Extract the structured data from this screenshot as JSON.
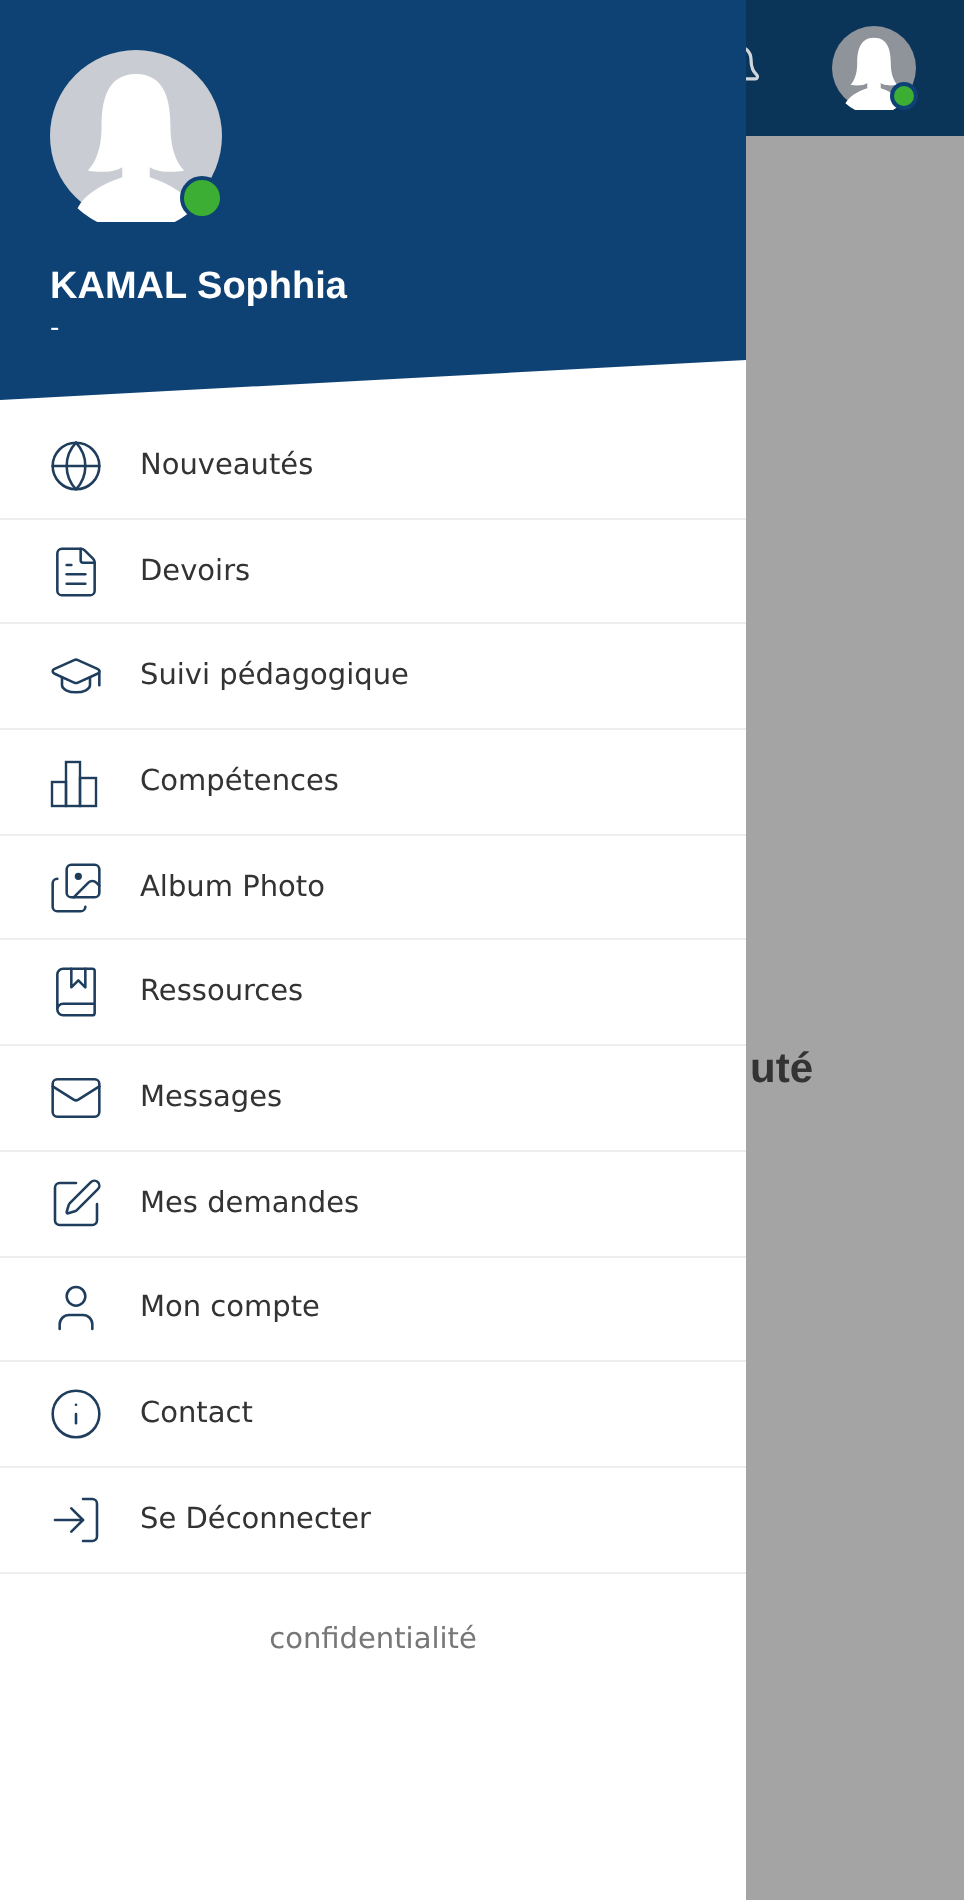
{
  "background": {
    "title_fragment": "uté",
    "user_online": true
  },
  "profile": {
    "name": "KAMAL Sophhia",
    "subtitle": "-",
    "online": true
  },
  "menu": [
    {
      "kind": "globe",
      "label": "Nouveautés"
    },
    {
      "kind": "document",
      "label": "Devoirs"
    },
    {
      "kind": "cap",
      "label": "Suivi pédagogique"
    },
    {
      "kind": "bars",
      "label": "Compétences"
    },
    {
      "kind": "photos",
      "label": "Album Photo"
    },
    {
      "kind": "book",
      "label": "Ressources"
    },
    {
      "kind": "mail",
      "label": "Messages"
    },
    {
      "kind": "edit",
      "label": "Mes demandes"
    },
    {
      "kind": "user",
      "label": "Mon compte"
    },
    {
      "kind": "info",
      "label": "Contact"
    },
    {
      "kind": "logout",
      "label": "Se Déconnecter"
    }
  ],
  "footer_link": "confidentialité"
}
